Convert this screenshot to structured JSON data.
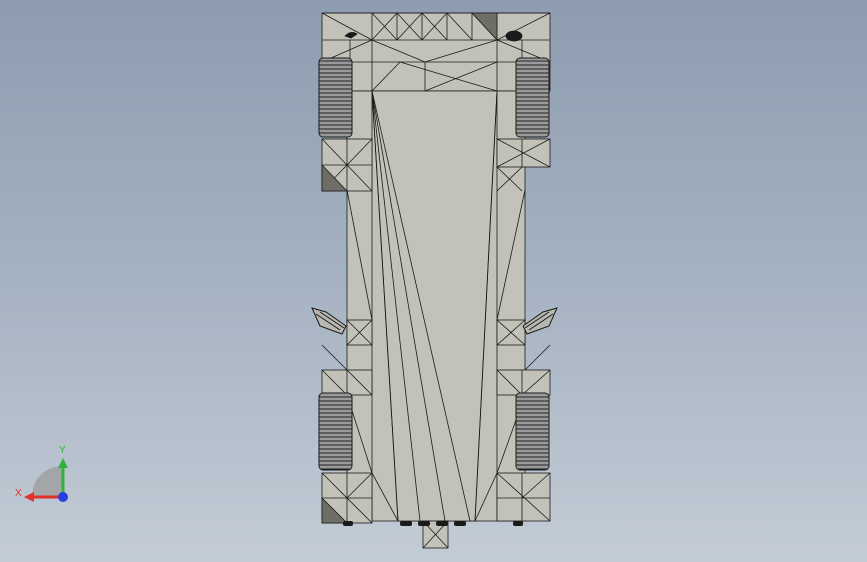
{
  "viewport": {
    "background_top": "#8d9cb0",
    "background_bottom": "#c3ccd6"
  },
  "model": {
    "face_color": "#c3c2b8",
    "edge_color": "#1a1a1a",
    "shadow_color": "#6f6e66",
    "tire_color": "#8e8e8e"
  },
  "triad": {
    "x_label": "X",
    "y_label": "Y",
    "x_color": "#e0322a",
    "y_color": "#2fb33b",
    "z_color": "#2a3ee0"
  }
}
